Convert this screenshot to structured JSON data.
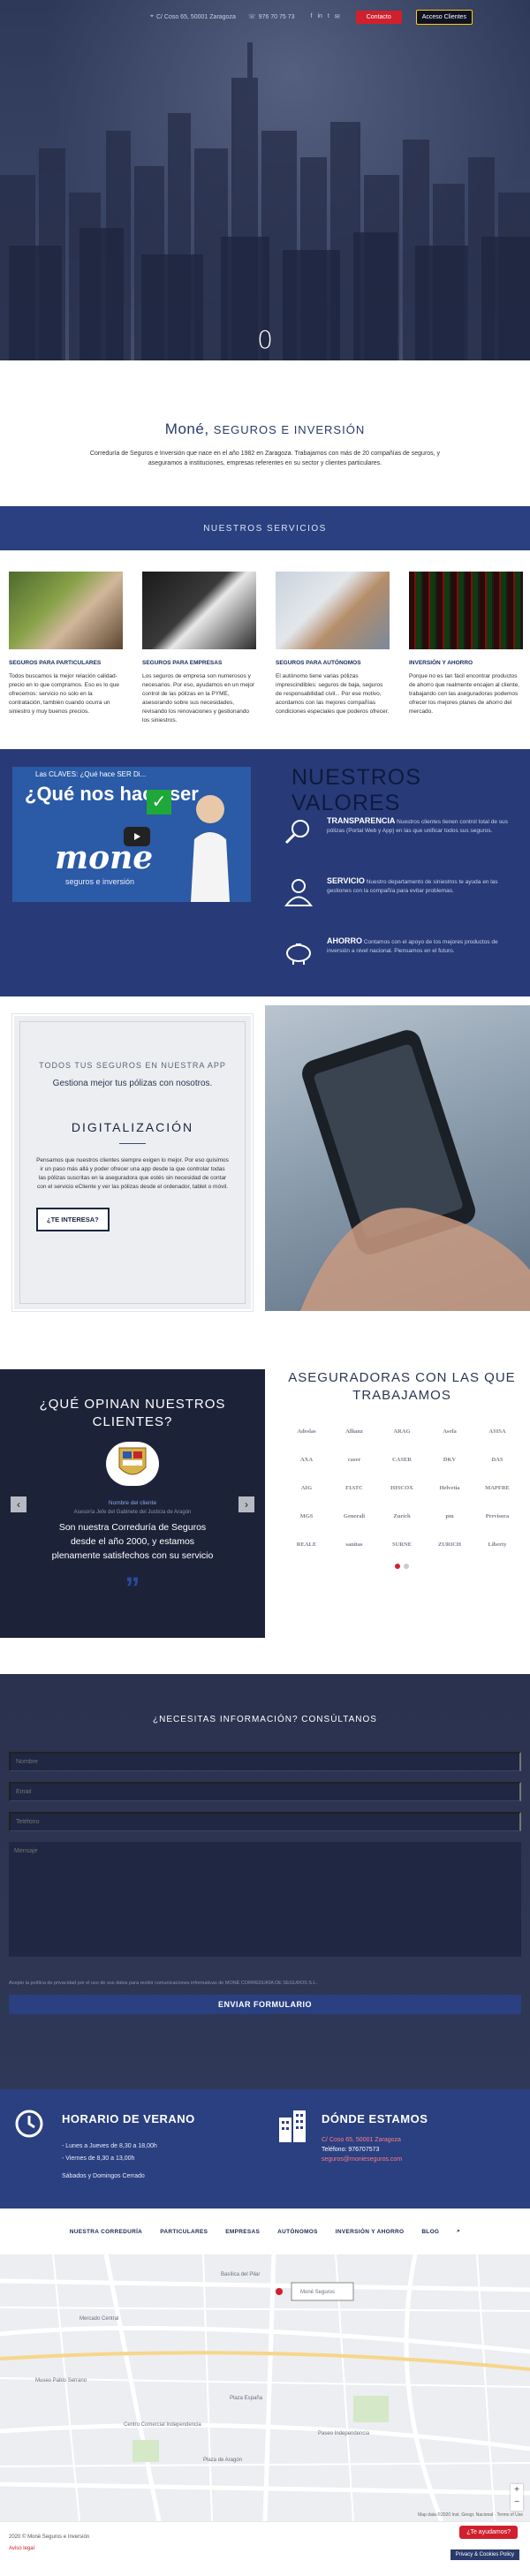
{
  "topbar": {
    "address": "C/ Coso 65, 50001 Zaragoza",
    "phone": "976 70 75 73",
    "contact_btn": "Contacto",
    "access_btn": "Acceso Clientes"
  },
  "hero": {
    "slide_number": "0"
  },
  "intro": {
    "title_brand": "Moné,",
    "title_sub": "SEGUROS E INVERSIÓN",
    "text": "Correduría de Seguros e Inversión que nace en el año 1982 en Zaragoza. Trabajamos con más de 20 compañías de seguros, y aseguramos a instituciones, empresas referentes en su sector y clientes particulares."
  },
  "services": {
    "heading": "NUESTROS SERVICIOS",
    "items": [
      {
        "title": "SEGUROS PARA PARTICULARES",
        "text": "Todos buscamos la mejor relación calidad-precio en lo que compramos. Eso es lo que ofrecemos: servicio no solo en la contratación, también cuando ocurra un siniestro y muy buenos precios."
      },
      {
        "title": "SEGUROS PARA EMPRESAS",
        "text": "Los seguros de empresa son numerosos y necesarios. Por eso, ayudamos en un mejor control de las pólizas en la PYME, asesorando sobre sus necesidades, revisando los renovaciones y gestionando los siniestros."
      },
      {
        "title": "SEGUROS PARA AUTÓNOMOS",
        "text": "El autónomo tiene varias pólizas imprescindibles: seguros de baja, seguros de responsabilidad civil... Por ese motivo, acordamos con las mejores compañías condiciones especiales que poderos ofrecer."
      },
      {
        "title": "INVERSIÓN Y AHORRO",
        "text": "Porque no es tan fácil encontrar productos de ahorro que realmente encajen al cliente, trabajando con las aseguradoras podemos ofrecer los mejores planes de ahorro del mercado."
      }
    ]
  },
  "values": {
    "heading": "NUESTROS VALORES",
    "video": {
      "title": "Las CLAVES: ¿Qué hace SER Di...",
      "big": "¿Qué nos hace ser",
      "brand": "mone",
      "tag": "seguros e inversión"
    },
    "items": [
      {
        "title": "TRANSPARENCIA",
        "text": "Nuestros clientes tienen control total de sus pólizas (Portal Web y App) en las que unificar todos sus seguros."
      },
      {
        "title": "SERVICIO",
        "text": "Nuestro departamento de siniestros te ayuda en las gestiones con la compañía para evitar problemas."
      },
      {
        "title": "AHORRO",
        "text": "Contamos con el apoyo de los mejores productos de inversión a nivel nacional. Piensamos en el futuro."
      }
    ]
  },
  "app": {
    "kicker": "TODOS TUS SEGUROS EN NUESTRA APP",
    "lead": "Gestiona mejor tus pólizas con nosotros.",
    "title": "DIGITALIZACIÓN",
    "text": "Pensamos que nuestros clientes siempre exigen lo mejor. Por eso quisimos ir un paso más allá y poder ofrecer una app desde la que controlar todas las pólizas suscritas en la aseguradora que estés sin necesidad de contar con el servicio eCliente y ver las pólizas desde el ordenador, tablet o móvil.",
    "button": "¿TE INTERESA?"
  },
  "opinions": {
    "heading": "¿QUÉ OPINAN NUESTROS CLIENTES?",
    "who": "Nombre del cliente",
    "role": "Asesoría Jefe del Gabinete del Justicia de Aragón",
    "quote": "Son nuestra Correduría de Seguros desde el año 2000, y estamos plenamente satisfechos con su servicio",
    "prev": "‹",
    "next": "›"
  },
  "insurers": {
    "heading": "ASEGURADORAS CON LAS QUE TRABAJAMOS",
    "logos": [
      "Adeslas",
      "Allianz",
      "ARAG",
      "Asefa",
      "ASISA",
      "AXA",
      "caser",
      "CASER",
      "DKV",
      "DAS",
      "AIG",
      "FIATC",
      "HISCOX",
      "Helvetia",
      "MAPFRE",
      "MGS",
      "Generali",
      "Zurich",
      "pm",
      "Previsora",
      "REALE",
      "sanitas",
      "SURNE",
      "ZURICH",
      "Liberty"
    ]
  },
  "form": {
    "heading": "¿NECESITAS INFORMACIÓN? CONSÚLTANOS",
    "name_ph": "Nombre",
    "email_ph": "Email",
    "phone_ph": "Teléfono",
    "msg_ph": "Mensaje",
    "legal": "Acepto la política de privacidad por el uso de sus datos para recibir comunicaciones informativas de MONÉ CORREDURÍA DE SEGUROS S.L.",
    "submit": "ENVIAR FORMULARIO"
  },
  "schedule": {
    "title": "HORARIO DE VERANO",
    "line1": "- Lunes a Jueves de 8,30 a 18,00h",
    "line2": "- Viernes de 8,30 a 13,00h",
    "line3": "Sábados y Domingos Cerrado",
    "where_title": "DÓNDE ESTAMOS",
    "address": "C/ Coso 65, 50001 Zaragoza",
    "phone": "Teléfono: 976707573",
    "email": "seguros@monieseguros.com"
  },
  "nav": [
    "NUESTRA CORREDURÍA",
    "PARTICULARES",
    "EMPRESAS",
    "AUTÓNOMOS",
    "INVERSIÓN Y AHORRO",
    "BLOG"
  ],
  "map": {
    "labels": [
      "Moné Seguros",
      "Mercado Central",
      "Basílica del Pilar",
      "Plaza España",
      "Plaza de Aragón",
      "Museo Pablo Serrano",
      "Centro Comercial Independencia",
      "Paseo Independencia"
    ],
    "credits": "Map data ©2020 Inst. Geogr. Nacional · Terms of Use"
  },
  "footer": {
    "copy": "2020 © Moné Seguros e Inversión",
    "legal": "Aviso legal",
    "chat": "¿Te ayudamos?",
    "cookies": "Privacy & Cookies Policy"
  },
  "colors": {
    "navy": "#2a4080",
    "accent": "#d0202e",
    "dark": "#1c2339"
  }
}
